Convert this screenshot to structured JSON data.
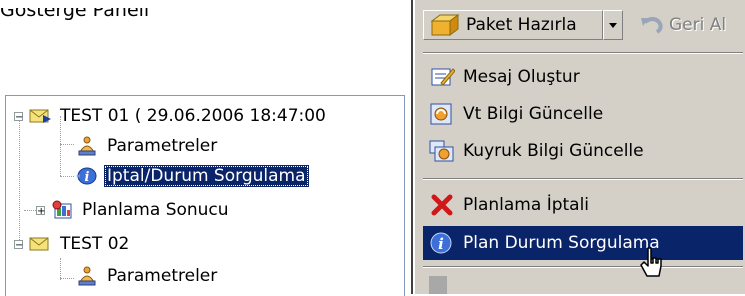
{
  "caption": {
    "text": "Gösterge Paneli"
  },
  "tree": {
    "items": [
      {
        "label": "TEST 01  ( 29.06.2006 18:47:00",
        "icon": "mail-envelope-icon",
        "expander": "minus"
      },
      {
        "label": "Parametreler",
        "icon": "settings-bell-icon"
      },
      {
        "label": "Iptal/Durum Sorgulama",
        "icon": "info-query-icon",
        "selected": true
      },
      {
        "label": "Planlama Sonucu",
        "icon": "plan-result-icon",
        "expander": "plus"
      },
      {
        "label": "TEST 02",
        "icon": "mail-envelope-icon",
        "expander": "minus"
      },
      {
        "label": "Parametreler",
        "icon": "settings-bell-icon"
      }
    ]
  },
  "toolbar": {
    "package_label": "Paket Hazırla",
    "undo_label": "Geri Al"
  },
  "menu": {
    "items": [
      {
        "label": "Mesaj Oluştur",
        "icon": "compose-message-icon"
      },
      {
        "label": "Vt Bilgi Güncelle",
        "icon": "db-update-icon"
      },
      {
        "label": "Kuyruk Bilgi Güncelle",
        "icon": "queue-update-icon"
      },
      {
        "label": "Planlama İptali",
        "icon": "red-x-cancel-icon"
      },
      {
        "label": "Plan Durum Sorgulama",
        "icon": "info-icon",
        "highlighted": true
      }
    ]
  },
  "colors": {
    "selection": "#0a246a",
    "menu_bg": "#d4d0c8",
    "tree_border": "#7f9db9"
  }
}
